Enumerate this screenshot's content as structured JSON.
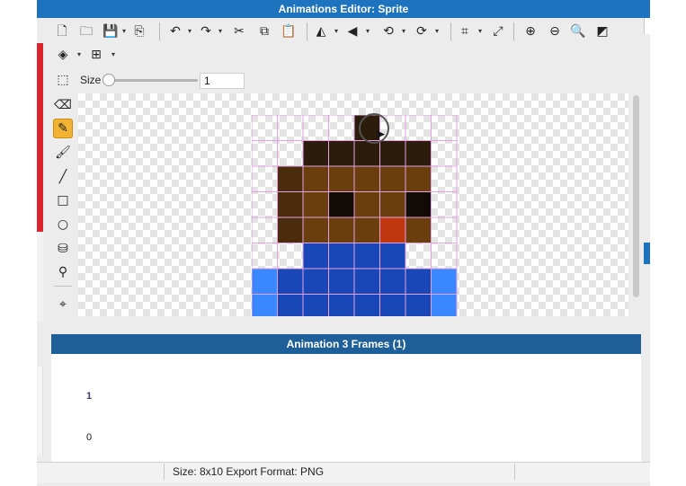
{
  "window": {
    "title": "Animations Editor: Sprite"
  },
  "toolbar": {
    "row1": [
      {
        "name": "new-file-icon",
        "glyph": "🗋"
      },
      {
        "name": "open-folder-icon",
        "glyph": "🗀"
      },
      {
        "name": "save-icon",
        "glyph": "💾"
      },
      {
        "name": "save-dropdown-icon",
        "glyph": "▾"
      },
      {
        "name": "export-icon",
        "glyph": "⎘"
      },
      {
        "name": "undo-icon",
        "glyph": "↶"
      },
      {
        "name": "undo-dropdown-icon",
        "glyph": "▾"
      },
      {
        "name": "redo-icon",
        "glyph": "↷"
      },
      {
        "name": "redo-dropdown-icon",
        "glyph": "▾"
      },
      {
        "name": "cut-icon",
        "glyph": "✂"
      },
      {
        "name": "copy-icon",
        "glyph": "⧉"
      },
      {
        "name": "paste-icon",
        "glyph": "📋"
      },
      {
        "name": "flip-horizontal-icon",
        "glyph": "◭"
      },
      {
        "name": "flip-h-dropdown-icon",
        "glyph": "▾"
      },
      {
        "name": "flip-vertical-icon",
        "glyph": "◀"
      },
      {
        "name": "flip-v-dropdown-icon",
        "glyph": "▾"
      },
      {
        "name": "rotate-left-icon",
        "glyph": "⟲"
      },
      {
        "name": "rotate-left-dropdown-icon",
        "glyph": "▾"
      },
      {
        "name": "rotate-right-icon",
        "glyph": "⟳"
      },
      {
        "name": "rotate-right-dropdown-icon",
        "glyph": "▾"
      },
      {
        "name": "crop-icon",
        "glyph": "⌗"
      },
      {
        "name": "crop-dropdown-icon",
        "glyph": "▾"
      },
      {
        "name": "resize-icon",
        "glyph": "⤢"
      },
      {
        "name": "zoom-in-icon",
        "glyph": "⊕"
      },
      {
        "name": "zoom-out-icon",
        "glyph": "⊖"
      },
      {
        "name": "zoom-fit-icon",
        "glyph": "🔍"
      },
      {
        "name": "background-toggle-icon",
        "glyph": "◩"
      }
    ],
    "row2": [
      {
        "name": "layers-icon",
        "glyph": "◈"
      },
      {
        "name": "layers-dropdown-icon",
        "glyph": "▾"
      },
      {
        "name": "grid-icon",
        "glyph": "⊞"
      },
      {
        "name": "grid-dropdown-icon",
        "glyph": "▾"
      }
    ],
    "selection_icon": {
      "name": "selection-marquee-icon",
      "glyph": "⬚"
    },
    "size_label": "Size",
    "size_value": "1"
  },
  "tools": [
    {
      "name": "eraser-tool-icon",
      "glyph": "⌫",
      "active": false
    },
    {
      "name": "pencil-tool-icon",
      "glyph": "✎",
      "active": true
    },
    {
      "name": "brush-tool-icon",
      "glyph": "🖌",
      "active": false
    },
    {
      "name": "line-tool-icon",
      "glyph": "╱",
      "active": false
    },
    {
      "name": "rectangle-tool-icon",
      "glyph": "□",
      "active": false
    },
    {
      "name": "ellipse-tool-icon",
      "glyph": "○",
      "active": false
    },
    {
      "name": "fill-bucket-tool-icon",
      "glyph": "⛁",
      "active": false
    },
    {
      "name": "eyedropper-tool-icon",
      "glyph": "⚲",
      "active": false
    },
    {
      "name": "hotspot-tool-icon",
      "glyph": "⌖",
      "active": false
    }
  ],
  "sprite": {
    "cols": 8,
    "rows": 8,
    "palette": {
      ".": "transparent",
      "k": "#2b1c0c",
      "d": "#4b2c0c",
      "b": "#6b3e0e",
      "e": "#120a04",
      "n": "#c0360e",
      "B": "#1a47b8",
      "L": "#3b87ff"
    },
    "pixels": [
      "....k...",
      "..kkkkk.",
      ".dbbbbb.",
      ".dbebbe.",
      ".dbbbnb.",
      "..BBBB..",
      "LBBBBBBL",
      "LBBBBBBL"
    ],
    "gridline_color": "#e3a3e3"
  },
  "animation": {
    "header": "Animation 3 Frames (1)",
    "frame_marker": "1",
    "frame_index": "0"
  },
  "status": {
    "text": "Size: 8x10   Export Format: PNG"
  }
}
